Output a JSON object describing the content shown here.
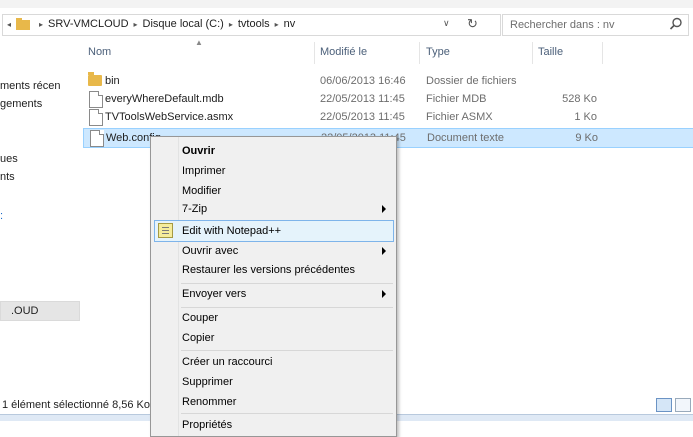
{
  "address": {
    "breadcrumbs": [
      "SRV-VMCLOUD",
      "Disque local (C:)",
      "tvtools",
      "nv"
    ],
    "search_placeholder": "Rechercher dans : nv"
  },
  "nav": {
    "items": [
      "ments récen",
      "gements",
      "ues",
      "nts",
      "",
      ".OUD"
    ]
  },
  "columns": {
    "name": "Nom",
    "modified": "Modifié le",
    "type": "Type",
    "size": "Taille"
  },
  "files": [
    {
      "name": "bin",
      "modified": "06/06/2013 16:46",
      "type": "Dossier de fichiers",
      "size": "",
      "icon": "folder-icon"
    },
    {
      "name": "everyWhereDefault.mdb",
      "modified": "22/05/2013 11:45",
      "type": "Fichier MDB",
      "size": "528 Ko",
      "icon": "file-icon"
    },
    {
      "name": "TVToolsWebService.asmx",
      "modified": "22/05/2013 11:45",
      "type": "Fichier ASMX",
      "size": "1 Ko",
      "icon": "file-icon"
    },
    {
      "name": "Web.config",
      "modified": "22/05/2013 11:45",
      "type": "Document texte",
      "size": "9 Ko",
      "icon": "file-icon"
    }
  ],
  "context_menu": {
    "items": [
      "Ouvrir",
      "Imprimer",
      "Modifier",
      "7-Zip",
      "Edit with Notepad++",
      "Ouvrir avec",
      "Restaurer les versions précédentes",
      "Envoyer vers",
      "Couper",
      "Copier",
      "Créer un raccourci",
      "Supprimer",
      "Renommer",
      "Propriétés"
    ]
  },
  "status": {
    "text": "1 élément sélectionné  8,56 Ko"
  },
  "colors": {
    "selection_bg": "#cde8ff",
    "selection_border": "#99d1ff",
    "menu_highlight": "#e5f3fb",
    "menu_highlight_border": "#7eb4ea",
    "header_text": "#4c607a"
  }
}
